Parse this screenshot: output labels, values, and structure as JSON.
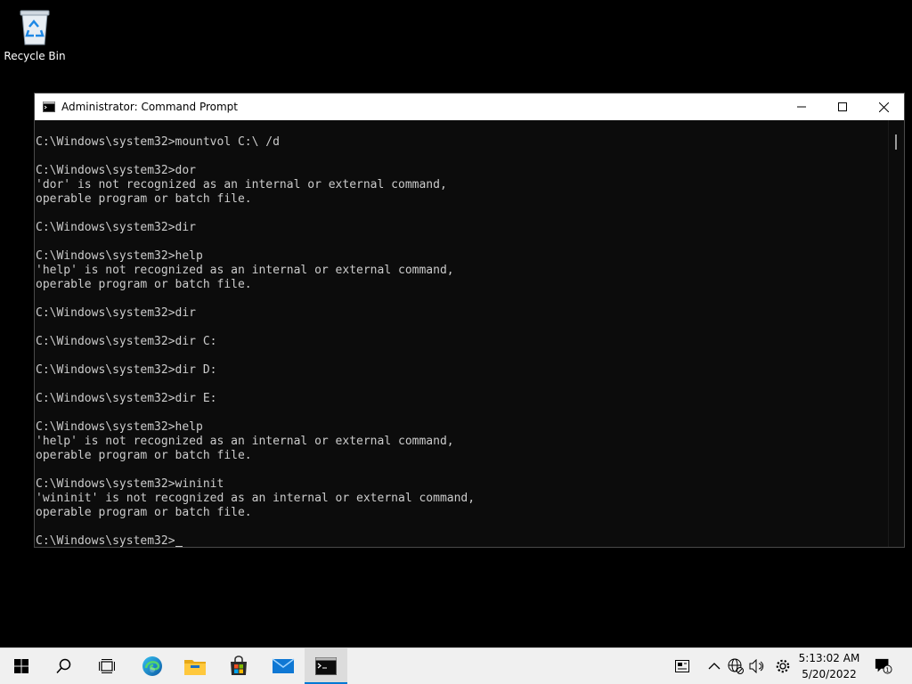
{
  "desktop": {
    "recycle_bin_label": "Recycle Bin"
  },
  "window": {
    "title": "Administrator: Command Prompt",
    "icon": "cmd-icon"
  },
  "console": {
    "lines": [
      "C:\\Windows\\system32>mountvol C:\\ /d",
      "",
      "C:\\Windows\\system32>dor",
      "'dor' is not recognized as an internal or external command,",
      "operable program or batch file.",
      "",
      "C:\\Windows\\system32>dir",
      "",
      "C:\\Windows\\system32>help",
      "'help' is not recognized as an internal or external command,",
      "operable program or batch file.",
      "",
      "C:\\Windows\\system32>dir",
      "",
      "C:\\Windows\\system32>dir C:",
      "",
      "C:\\Windows\\system32>dir D:",
      "",
      "C:\\Windows\\system32>dir E:",
      "",
      "C:\\Windows\\system32>help",
      "'help' is not recognized as an internal or external command,",
      "operable program or batch file.",
      "",
      "C:\\Windows\\system32>wininit",
      "'wininit' is not recognized as an internal or external command,",
      "operable program or batch file.",
      ""
    ],
    "prompt": "C:\\Windows\\system32>"
  },
  "taskbar": {
    "items": [
      "start-icon",
      "search-icon",
      "task-view-icon",
      "edge-icon",
      "file-explorer-icon",
      "store-icon",
      "mail-icon",
      "cmd-icon"
    ],
    "tray": [
      "news-icon",
      "chevron-up-icon",
      "network-icon",
      "volume-icon",
      "settings-icon"
    ],
    "time": "5:13:02 AM",
    "date": "5/20/2022",
    "notification_count": "1"
  },
  "colors": {
    "accent": "#0078d4",
    "console_bg": "#0c0c0c",
    "console_fg": "#cccccc"
  }
}
